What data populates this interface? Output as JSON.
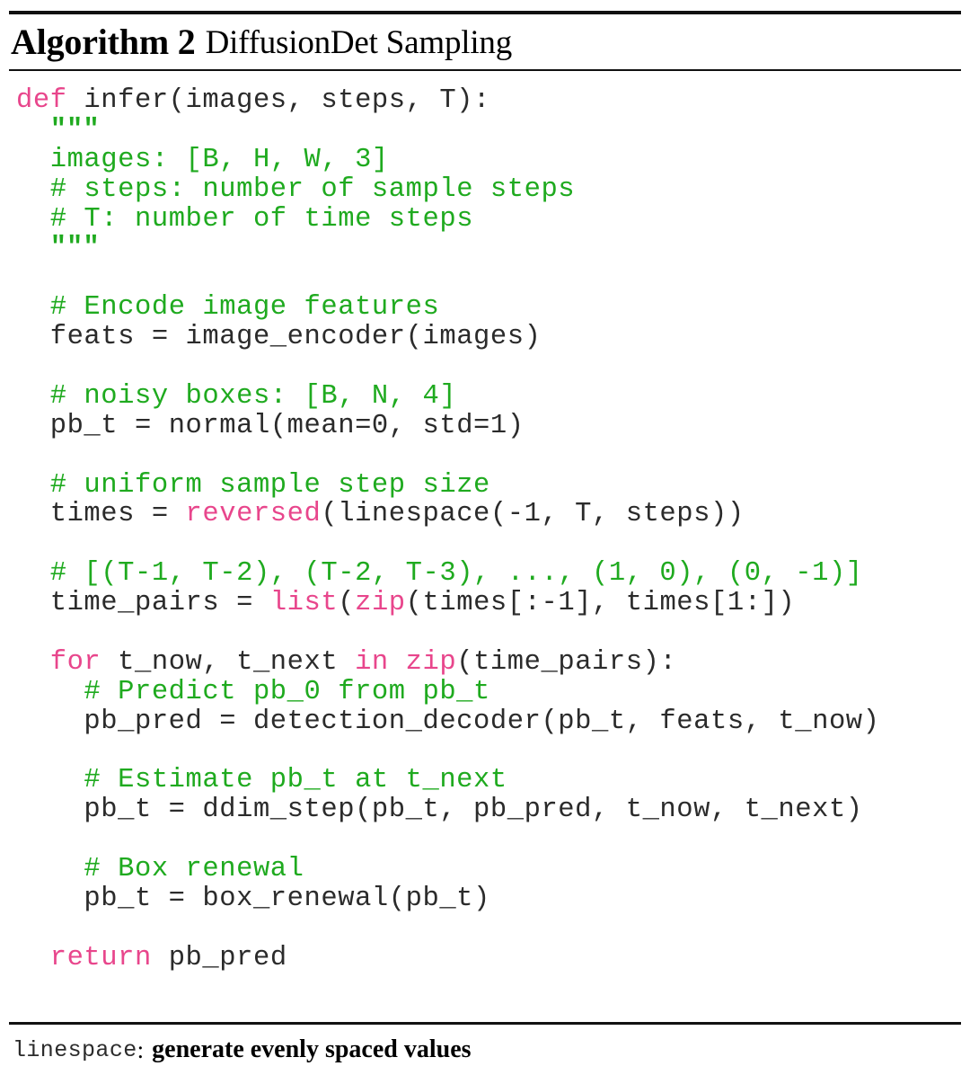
{
  "header": {
    "label": "Algorithm 2",
    "title": "DiffusionDet Sampling"
  },
  "colors": {
    "keyword": "#e8468c",
    "builtin": "#e8468c",
    "comment": "#1faa1f",
    "string": "#1faa1f",
    "plain": "#2b2b2b",
    "rule": "#111111",
    "background": "#ffffff"
  },
  "code": {
    "language": "python",
    "lines": [
      {
        "indent": 0,
        "tokens": [
          {
            "t": "kw",
            "s": "def"
          },
          {
            "t": "pl",
            "s": " infer(images, steps, T):"
          }
        ]
      },
      {
        "indent": 1,
        "tokens": [
          {
            "t": "str",
            "s": "\"\"\""
          }
        ]
      },
      {
        "indent": 1,
        "tokens": [
          {
            "t": "cm",
            "s": "images: [B, H, W, 3]"
          }
        ]
      },
      {
        "indent": 1,
        "tokens": [
          {
            "t": "cm",
            "s": "# steps: number of sample steps"
          }
        ]
      },
      {
        "indent": 1,
        "tokens": [
          {
            "t": "cm",
            "s": "# T: number of time steps"
          }
        ]
      },
      {
        "indent": 1,
        "tokens": [
          {
            "t": "str",
            "s": "\"\"\""
          }
        ]
      },
      {
        "indent": 0,
        "blank": true,
        "tokens": []
      },
      {
        "indent": 1,
        "tokens": [
          {
            "t": "cm",
            "s": "# Encode image features"
          }
        ]
      },
      {
        "indent": 1,
        "tokens": [
          {
            "t": "pl",
            "s": "feats = image_encoder(images)"
          }
        ]
      },
      {
        "indent": 0,
        "blank": true,
        "tokens": []
      },
      {
        "indent": 1,
        "tokens": [
          {
            "t": "cm",
            "s": "# noisy boxes: [B, N, 4]"
          }
        ]
      },
      {
        "indent": 1,
        "tokens": [
          {
            "t": "pl",
            "s": "pb_t = normal(mean=0, std=1)"
          }
        ]
      },
      {
        "indent": 0,
        "blank": true,
        "tokens": []
      },
      {
        "indent": 1,
        "tokens": [
          {
            "t": "cm",
            "s": "# uniform sample step size"
          }
        ]
      },
      {
        "indent": 1,
        "tokens": [
          {
            "t": "pl",
            "s": "times = "
          },
          {
            "t": "bi",
            "s": "reversed"
          },
          {
            "t": "pl",
            "s": "(linespace(-1, T, steps))"
          }
        ]
      },
      {
        "indent": 0,
        "blank": true,
        "tokens": []
      },
      {
        "indent": 1,
        "tokens": [
          {
            "t": "cm",
            "s": "# [(T-1, T-2), (T-2, T-3), ..., (1, 0), (0, -1)]"
          }
        ]
      },
      {
        "indent": 1,
        "tokens": [
          {
            "t": "pl",
            "s": "time_pairs = "
          },
          {
            "t": "bi",
            "s": "list"
          },
          {
            "t": "pl",
            "s": "("
          },
          {
            "t": "bi",
            "s": "zip"
          },
          {
            "t": "pl",
            "s": "(times[:-1], times[1:])"
          }
        ]
      },
      {
        "indent": 0,
        "blank": true,
        "tokens": []
      },
      {
        "indent": 1,
        "tokens": [
          {
            "t": "kw",
            "s": "for"
          },
          {
            "t": "pl",
            "s": " t_now, t_next "
          },
          {
            "t": "kw",
            "s": "in"
          },
          {
            "t": "pl",
            "s": " "
          },
          {
            "t": "bi",
            "s": "zip"
          },
          {
            "t": "pl",
            "s": "(time_pairs):"
          }
        ]
      },
      {
        "indent": 2,
        "tokens": [
          {
            "t": "cm",
            "s": "# Predict pb_0 from pb_t"
          }
        ]
      },
      {
        "indent": 2,
        "tokens": [
          {
            "t": "pl",
            "s": "pb_pred = detection_decoder(pb_t, feats, t_now)"
          }
        ]
      },
      {
        "indent": 0,
        "blank": true,
        "tokens": []
      },
      {
        "indent": 2,
        "tokens": [
          {
            "t": "cm",
            "s": "# Estimate pb_t at t_next"
          }
        ]
      },
      {
        "indent": 2,
        "tokens": [
          {
            "t": "pl",
            "s": "pb_t = ddim_step(pb_t, pb_pred, t_now, t_next)"
          }
        ]
      },
      {
        "indent": 0,
        "blank": true,
        "tokens": []
      },
      {
        "indent": 2,
        "tokens": [
          {
            "t": "cm",
            "s": "# Box renewal"
          }
        ]
      },
      {
        "indent": 2,
        "tokens": [
          {
            "t": "pl",
            "s": "pb_t = box_renewal(pb_t)"
          }
        ]
      },
      {
        "indent": 0,
        "blank": true,
        "tokens": []
      },
      {
        "indent": 1,
        "tokens": [
          {
            "t": "kw",
            "s": "return"
          },
          {
            "t": "pl",
            "s": " pb_pred"
          }
        ]
      }
    ]
  },
  "footnote": {
    "term": "linespace",
    "separator": ":",
    "description": "generate evenly spaced values"
  }
}
